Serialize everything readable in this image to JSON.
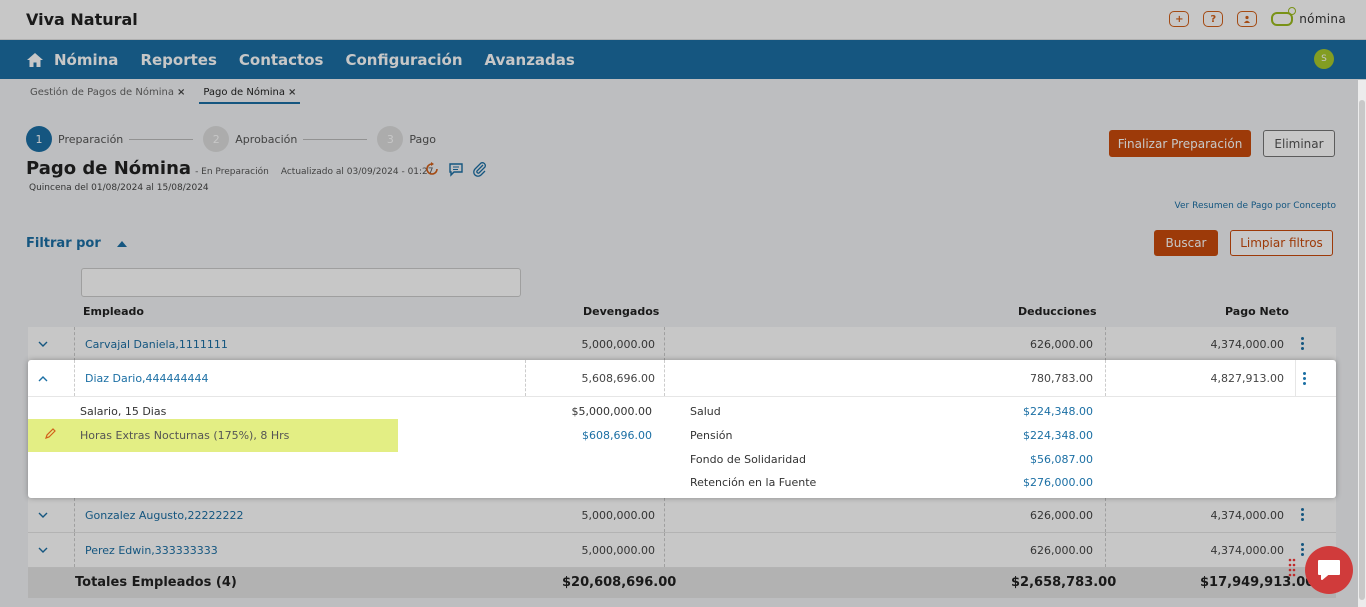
{
  "header": {
    "company": "Viva Natural",
    "logo_text": "nómina",
    "icons": [
      "plus-icon",
      "help-icon",
      "user-icon"
    ]
  },
  "nav": {
    "items": [
      "Nómina",
      "Reportes",
      "Contactos",
      "Configuración",
      "Avanzadas"
    ],
    "badge": "S"
  },
  "tabs": [
    {
      "label": "Gestión de Pagos de Nómina",
      "active": false
    },
    {
      "label": "Pago de Nómina",
      "active": true
    }
  ],
  "stepper": [
    {
      "num": "1",
      "label": "Preparación"
    },
    {
      "num": "2",
      "label": "Aprobación"
    },
    {
      "num": "3",
      "label": "Pago"
    }
  ],
  "page": {
    "title": "Pago de Nómina",
    "status": "- En Preparación",
    "updated": "Actualizado al 03/09/2024 - 01:27",
    "period": "Quincena del 01/08/2024 al 15/08/2024",
    "finalize_label": "Finalizar Preparación",
    "delete_label": "Eliminar",
    "summary_link": "Ver Resumen de Pago por Concepto"
  },
  "filter": {
    "label": "Filtrar por",
    "search_label": "Buscar",
    "clear_label": "Limpiar filtros"
  },
  "table": {
    "headers": {
      "employee": "Empleado",
      "earnings": "Devengados",
      "deductions": "Deducciones",
      "net": "Pago Neto"
    },
    "rows": [
      {
        "employee": "Carvajal Daniela,1111111",
        "earnings": "5,000,000.00",
        "deductions": "626,000.00",
        "net": "4,374,000.00"
      },
      {
        "employee": "Diaz Dario,444444444",
        "earnings": "5,608,696.00",
        "deductions": "780,783.00",
        "net": "4,827,913.00"
      },
      {
        "employee": "Gonzalez Augusto,22222222",
        "earnings": "5,000,000.00",
        "deductions": "626,000.00",
        "net": "4,374,000.00"
      },
      {
        "employee": "Perez Edwin,333333333",
        "earnings": "5,000,000.00",
        "deductions": "626,000.00",
        "net": "4,374,000.00"
      }
    ],
    "expanded_detail": {
      "earnings": [
        {
          "concept": "Salario, 15 Dias",
          "amount": "$5,000,000.00"
        },
        {
          "concept": "Horas Extras Nocturnas (175%), 8 Hrs",
          "amount": "$608,696.00"
        }
      ],
      "deductions": [
        {
          "concept": "Salud",
          "amount": "$224,348.00"
        },
        {
          "concept": "Pensión",
          "amount": "$224,348.00"
        },
        {
          "concept": "Fondo de Solidaridad",
          "amount": "$56,087.00"
        },
        {
          "concept": "Retención en la Fuente",
          "amount": "$276,000.00"
        }
      ]
    },
    "totals": {
      "label": "Totales Empleados (4)",
      "earnings": "$20,608,696.00",
      "deductions": "$2,658,783.00",
      "net": "$17,949,913.00"
    }
  },
  "colors": {
    "primary": "#1b6fa4",
    "accent": "#c94b0c",
    "highlight": "#e3ee84",
    "brand": "#9cbb1e"
  }
}
